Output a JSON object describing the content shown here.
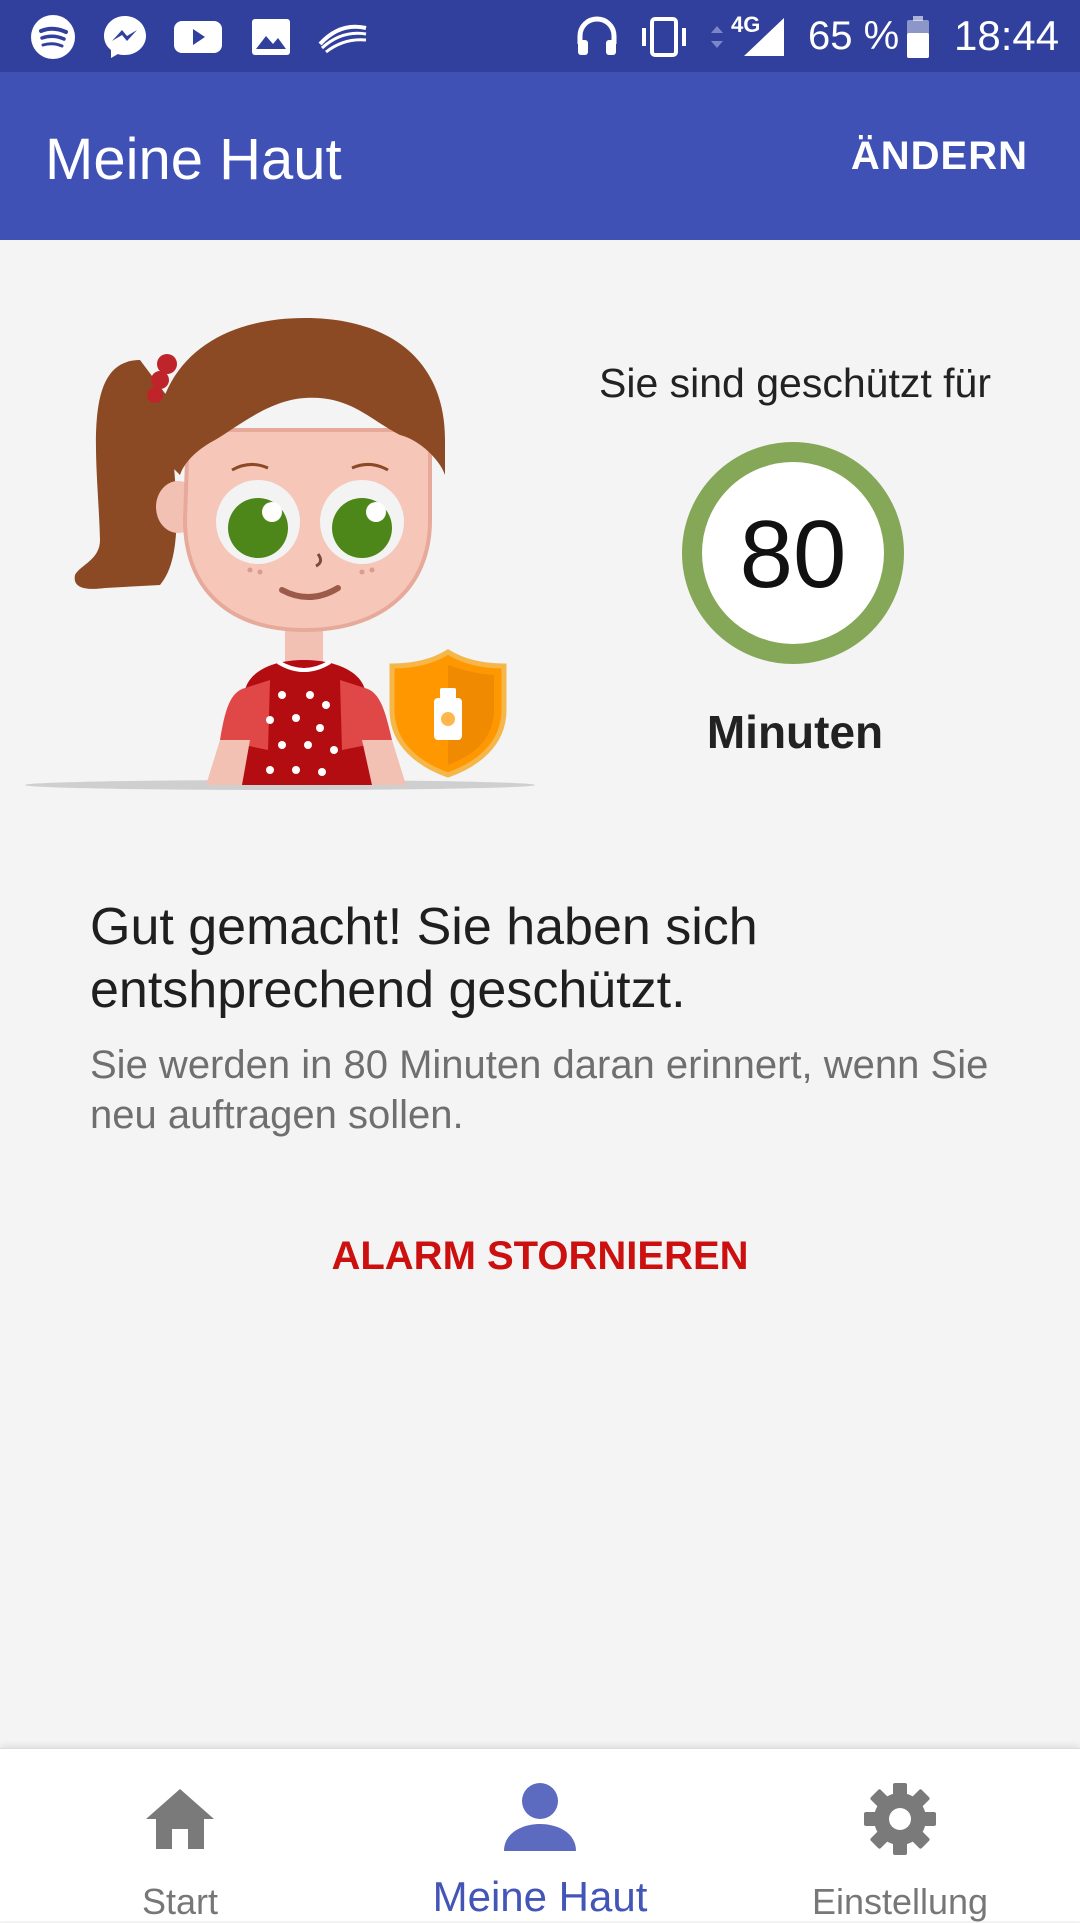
{
  "status_bar": {
    "left_icons": [
      "spotify-icon",
      "messenger-icon",
      "youtube-icon",
      "gallery-icon",
      "swiftkey-icon"
    ],
    "right_icons": [
      "headphones-icon",
      "vibrate-icon",
      "data-arrows-icon",
      "signal-icon",
      "battery-icon"
    ],
    "network": "4G",
    "battery": "65 %",
    "time": "18:44"
  },
  "appbar": {
    "title": "Meine Haut",
    "action": "ÄNDERN"
  },
  "protection": {
    "label": "Sie sind geschützt für",
    "minutes": "80",
    "unit": "Minuten",
    "ring_color": "#85a858"
  },
  "illustration": {
    "figure": "girl-avatar",
    "badge": "sunscreen-shield-icon",
    "badge_color": "#ff9800"
  },
  "message": {
    "title": "Gut gemacht! Sie haben sich entshprechend geschützt.",
    "subtitle": "Sie werden in 80 Minuten daran erinnert, wenn Sie neu auftragen sollen."
  },
  "actions": {
    "cancel_alarm": "ALARM STORNIEREN"
  },
  "bottom_nav": {
    "items": [
      {
        "label": "Start",
        "icon": "home-icon",
        "active": false
      },
      {
        "label": "Meine Haut",
        "icon": "person-icon",
        "active": true
      },
      {
        "label": "Einstellung",
        "icon": "gear-icon",
        "active": false
      }
    ],
    "active_color": "#4455b8",
    "inactive_color": "#777777"
  }
}
